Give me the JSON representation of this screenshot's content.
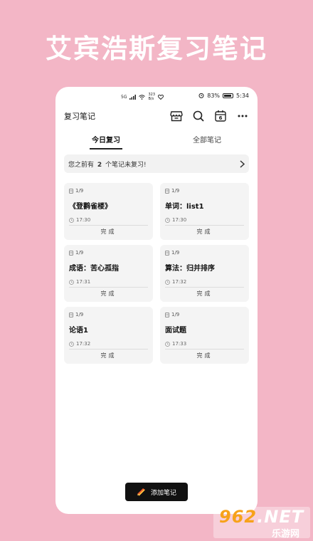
{
  "banner": {
    "title": "艾宾浩斯复习笔记"
  },
  "status": {
    "net_speed_top": "323",
    "net_speed_bottom": "B/s",
    "battery": "83%",
    "time": "5:34",
    "signal_label": "5G"
  },
  "appbar": {
    "title": "复习笔记",
    "calendar_day": "6"
  },
  "tabs": [
    {
      "label": "今日复习",
      "active": true
    },
    {
      "label": "全部笔记",
      "active": false
    }
  ],
  "notice": {
    "prefix": "您之前有",
    "count": "2",
    "suffix": "个笔记未复习!"
  },
  "cards": [
    {
      "progress": "1/9",
      "title": "《登鹳雀楼》",
      "time": "17:30",
      "action": "完成"
    },
    {
      "progress": "1/9",
      "title": "单词：list1",
      "time": "17:30",
      "action": "完成"
    },
    {
      "progress": "1/9",
      "title": "成语：苦心孤指",
      "time": "17:31",
      "action": "完成"
    },
    {
      "progress": "1/9",
      "title": "算法：归并排序",
      "time": "17:32",
      "action": "完成"
    },
    {
      "progress": "1/9",
      "title": "论语1",
      "time": "17:32",
      "action": "完成"
    },
    {
      "progress": "1/9",
      "title": "面试题",
      "time": "17:33",
      "action": "完成"
    }
  ],
  "add_button": {
    "label": "添加笔记"
  },
  "watermark": {
    "brand": "962",
    "suffix": ".NET",
    "sub": "乐游网"
  },
  "colors": {
    "background": "#f3b6c6",
    "accent": "#111111",
    "card": "#f4f4f4",
    "logo_orange": "#f7a21a"
  }
}
